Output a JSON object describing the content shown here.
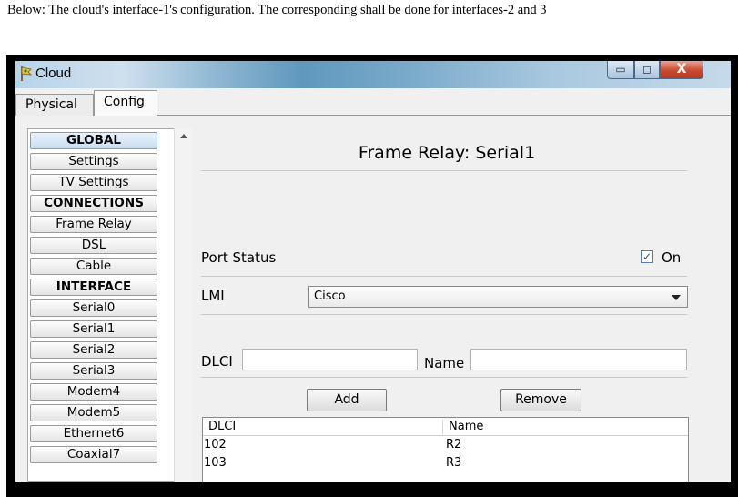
{
  "caption": "Below: The cloud's interface-1's configuration. The corresponding shall be done for interfaces-2 and 3",
  "window": {
    "title": "Cloud",
    "controls": {
      "minimize": "▭",
      "maximize": "◻",
      "close": "X"
    }
  },
  "tabs": [
    {
      "label": "Physical",
      "selected": false
    },
    {
      "label": "Config",
      "selected": true
    }
  ],
  "sidebar": {
    "items": [
      {
        "label": "GLOBAL",
        "type": "header"
      },
      {
        "label": "Settings",
        "type": "item"
      },
      {
        "label": "TV Settings",
        "type": "item"
      },
      {
        "label": "CONNECTIONS",
        "type": "header"
      },
      {
        "label": "Frame Relay",
        "type": "item"
      },
      {
        "label": "DSL",
        "type": "item"
      },
      {
        "label": "Cable",
        "type": "item"
      },
      {
        "label": "INTERFACE",
        "type": "header"
      },
      {
        "label": "Serial0",
        "type": "item"
      },
      {
        "label": "Serial1",
        "type": "item"
      },
      {
        "label": "Serial2",
        "type": "item"
      },
      {
        "label": "Serial3",
        "type": "item"
      },
      {
        "label": "Modem4",
        "type": "item"
      },
      {
        "label": "Modem5",
        "type": "item"
      },
      {
        "label": "Ethernet6",
        "type": "item"
      },
      {
        "label": "Coaxial7",
        "type": "item"
      }
    ]
  },
  "panel": {
    "title": "Frame Relay: Serial1",
    "port_status_label": "Port Status",
    "port_status_checked": true,
    "port_status_on_label": "On",
    "lmi_label": "LMI",
    "lmi_value": "Cisco",
    "dlci_label": "DLCI",
    "dlci_value": "",
    "name_label": "Name",
    "name_value": "",
    "add_label": "Add",
    "remove_label": "Remove",
    "table": {
      "columns": [
        "DLCI",
        "Name"
      ],
      "rows": [
        [
          "102",
          "R2"
        ],
        [
          "103",
          "R3"
        ]
      ]
    }
  }
}
